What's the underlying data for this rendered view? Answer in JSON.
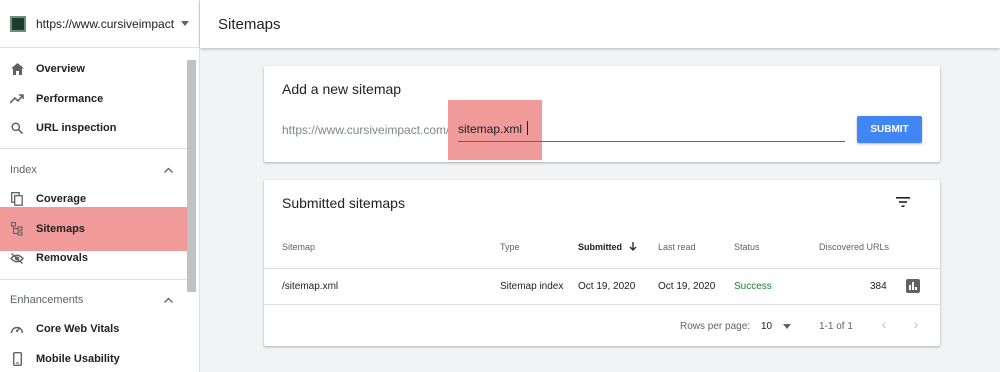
{
  "property": {
    "url": "https://www.cursiveimpact.c..."
  },
  "sidebar": {
    "items_top": [
      {
        "label": "Overview",
        "icon": "home-icon"
      },
      {
        "label": "Performance",
        "icon": "trending-up-icon"
      },
      {
        "label": "URL inspection",
        "icon": "search-icon"
      }
    ],
    "section_index": "Index",
    "items_index": [
      {
        "label": "Coverage",
        "icon": "copy-icon"
      },
      {
        "label": "Sitemaps",
        "icon": "sitemap-icon"
      },
      {
        "label": "Removals",
        "icon": "visibility-off-icon"
      }
    ],
    "section_enhancements": "Enhancements",
    "items_enh": [
      {
        "label": "Core Web Vitals",
        "icon": "speed-icon"
      },
      {
        "label": "Mobile Usability",
        "icon": "phone-icon"
      }
    ]
  },
  "header": {
    "title": "Sitemaps"
  },
  "add_sitemap": {
    "title": "Add a new sitemap",
    "prefix": "https://www.cursiveimpact.com/",
    "value": "sitemap.xml",
    "submit": "SUBMIT"
  },
  "submitted": {
    "title": "Submitted sitemaps",
    "columns": [
      "Sitemap",
      "Type",
      "Submitted",
      "Last read",
      "Status",
      "Discovered URLs"
    ],
    "rows": [
      {
        "sitemap": "/sitemap.xml",
        "type": "Sitemap index",
        "submitted": "Oct 19, 2020",
        "last_read": "Oct 19, 2020",
        "status": "Success",
        "discovered": "384"
      }
    ],
    "footer": {
      "rows_label": "Rows per page:",
      "rows_value": "10",
      "range": "1-1 of 1"
    }
  },
  "colors": {
    "accent": "#4285f4",
    "highlight": "#f19a9a",
    "success": "#188038"
  }
}
